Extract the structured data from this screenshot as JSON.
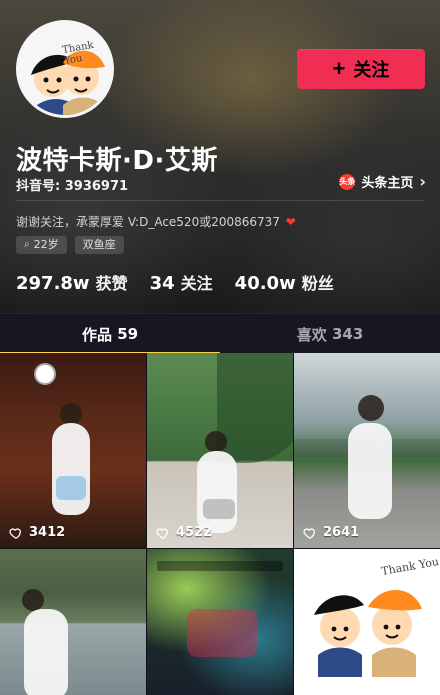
{
  "profile": {
    "name": "波特卡斯·D·艾斯",
    "douyin_id_label": "抖音号:",
    "douyin_id": "3936971",
    "follow_button_label": "关注",
    "toutiao_link_label": "头条主页",
    "toutiao_badge_text": "头条",
    "bio": "谢谢关注，承蒙厚爱 V:D_Ace520或200866737",
    "tags": [
      {
        "text": "22岁"
      },
      {
        "text": "双鱼座"
      }
    ],
    "stats": [
      {
        "value": "297.8w",
        "label": "获赞"
      },
      {
        "value": "34",
        "label": "关注"
      },
      {
        "value": "40.0w",
        "label": "粉丝"
      }
    ],
    "avatar_caption": "Thank You"
  },
  "tabs": [
    {
      "label": "作品",
      "count": "59",
      "active": true
    },
    {
      "label": "喜欢",
      "count": "343",
      "active": false
    }
  ],
  "videos": [
    {
      "likes": "3412"
    },
    {
      "likes": "4522"
    },
    {
      "likes": "2641"
    }
  ],
  "colors": {
    "primary_red": "#f02d52",
    "accent_yellow": "#ffd04a",
    "bg_dark": "#0f1018"
  },
  "icons": {
    "plus": "plus-icon",
    "chevron_right": "chevron-right-icon",
    "heart_outline": "heart-outline-icon",
    "search": "search-icon",
    "heart_emoji": "heart-emoji-icon",
    "toutiao": "toutiao-icon"
  }
}
